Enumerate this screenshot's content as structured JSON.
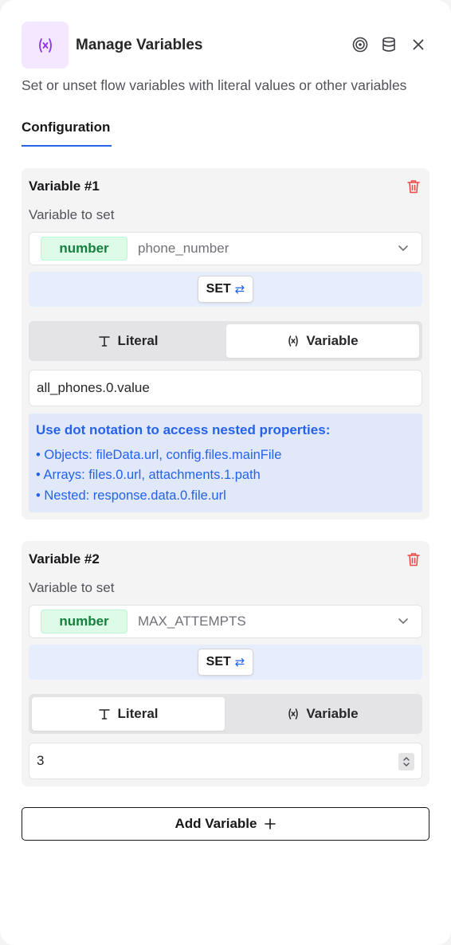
{
  "header": {
    "title": "Manage Variables",
    "description": "Set or unset flow variables with literal values or other variables",
    "icons": [
      "variable-icon",
      "target-icon",
      "database-icon",
      "close-icon"
    ]
  },
  "tabs": [
    {
      "label": "Configuration",
      "active": true
    }
  ],
  "variables": [
    {
      "title": "Variable #1",
      "field_label": "Variable to set",
      "type_badge": "number",
      "selected_variable": "phone_number",
      "operation": "SET",
      "mode_options": [
        "Literal",
        "Variable"
      ],
      "active_mode": "Variable",
      "value": "all_phones.0.value",
      "hint": {
        "title": "Use dot notation to access nested properties:",
        "items": [
          "• Objects: fileData.url, config.files.mainFile",
          "• Arrays: files.0.url, attachments.1.path",
          "• Nested: response.data.0.file.url"
        ]
      }
    },
    {
      "title": "Variable #2",
      "field_label": "Variable to set",
      "type_badge": "number",
      "selected_variable": "MAX_ATTEMPTS",
      "operation": "SET",
      "mode_options": [
        "Literal",
        "Variable"
      ],
      "active_mode": "Literal",
      "value": "3"
    }
  ],
  "add_button": {
    "label": "Add Variable"
  },
  "colors": {
    "accent": "#2563eb",
    "badge_bg": "#dcfce7",
    "badge_text": "#15803d",
    "danger": "#ef4444",
    "icon_purple": "#9333ea"
  }
}
